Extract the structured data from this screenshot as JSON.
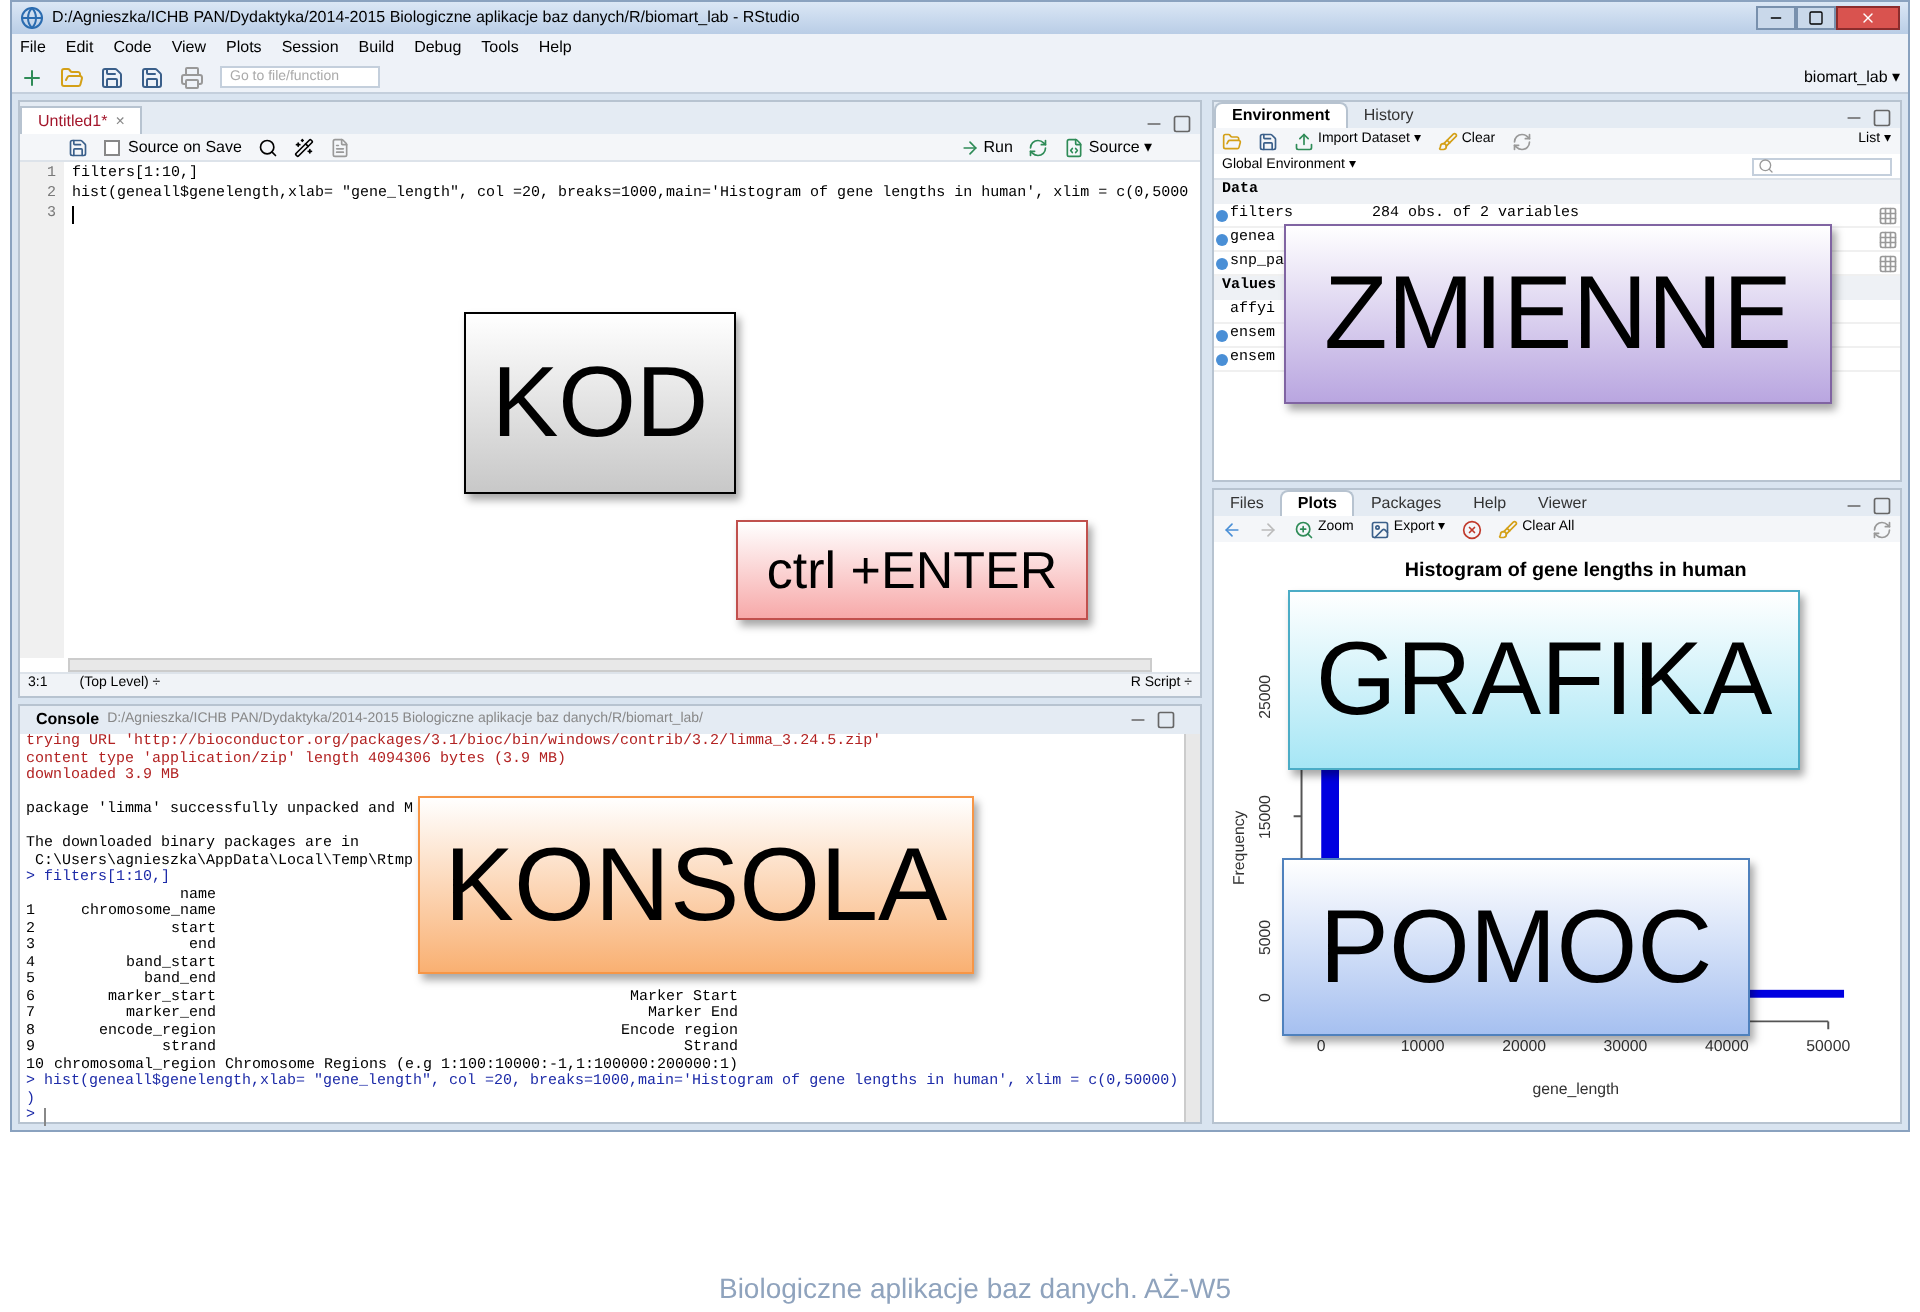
{
  "window": {
    "title": "D:/Agnieszka/ICHB PAN/Dydaktyka/2014-2015 Biologiczne aplikacje baz danych/R/biomart_lab - RStudio"
  },
  "menu": [
    "File",
    "Edit",
    "Code",
    "View",
    "Plots",
    "Session",
    "Build",
    "Debug",
    "Tools",
    "Help"
  ],
  "toolbar": {
    "goto_placeholder": "Go to file/function",
    "project": "biomart_lab ▾"
  },
  "editor": {
    "tabs": [
      {
        "label": "Untitled1*",
        "selected": true
      }
    ],
    "close": "×",
    "source_on_save": "Source on Save",
    "source_on_save_checked": false,
    "run": "Run",
    "source": "Source ▾",
    "lines": [
      {
        "number": "1",
        "code": "filters[1:10,]"
      },
      {
        "number": "2",
        "code": "hist(geneall$genelength,xlab= \"gene_length\", col =20, breaks=1000,main='Histogram of gene lengths in human', xlim = c(0,5000"
      },
      {
        "number": "3"
      }
    ],
    "status": {
      "position": "3:1",
      "scope": "(Top Level) ÷",
      "type": "R Script ÷"
    }
  },
  "console": {
    "title": "Console",
    "path": "D:/Agnieszka/ICHB PAN/Dydaktyka/2014-2015 Biologiczne aplikacje baz danych/R/biomart_lab/",
    "lines": [
      {
        "kind": "error",
        "text": "trying URL 'http://bioconductor.org/packages/3.1/bioc/bin/windows/contrib/3.2/limma_3.24.5.zip'"
      },
      {
        "kind": "error",
        "text": "content type 'application/zip' length 4094306 bytes (3.9 MB)"
      },
      {
        "kind": "error",
        "text": "downloaded 3.9 MB"
      },
      {
        "kind": "blank"
      },
      {
        "kind": "output",
        "text": "package 'limma' successfully unpacked and M"
      },
      {
        "kind": "blank"
      },
      {
        "kind": "output",
        "text": "The downloaded binary packages are in"
      },
      {
        "kind": "output",
        "text": " C:\\Users\\agnieszka\\AppData\\Local\\Temp\\Rtmp"
      },
      {
        "kind": "input",
        "text": "> filters[1:10,]"
      }
    ],
    "table": {
      "header": "name",
      "rows": [
        {
          "index": "1",
          "name": "chromosome_name"
        },
        {
          "index": "2",
          "name": "start"
        },
        {
          "index": "3",
          "name": "end"
        },
        {
          "index": "4",
          "name": "band_start"
        },
        {
          "index": "5",
          "name": "band_end"
        },
        {
          "index": "6",
          "name": "marker_start",
          "description": "Marker Start"
        },
        {
          "index": "7",
          "name": "marker_end",
          "description": "Marker End"
        },
        {
          "index": "8",
          "name": "encode_region",
          "description": "Encode region"
        },
        {
          "index": "9",
          "name": "strand",
          "description": "Strand"
        },
        {
          "index": "10",
          "name": "chromosomal_region",
          "description": "Chromosome Regions (e.g 1:100:10000:-1,1:100000:200000:1)"
        }
      ]
    },
    "after": [
      {
        "kind": "input",
        "text": "> hist(geneall$genelength,xlab= \"gene_length\", col =20, breaks=1000,main='Histogram of gene lengths in human', xlim = c(0,50000)"
      },
      {
        "kind": "input",
        "text": ")"
      },
      {
        "kind": "prompt",
        "text": ">"
      }
    ]
  },
  "environment": {
    "tabs": [
      {
        "label": "Environment",
        "selected": true
      },
      {
        "label": "History",
        "selected": false
      }
    ],
    "import": "Import Dataset ▾",
    "clear": "Clear",
    "view": "List ▾",
    "scope": "Global Environment ▾",
    "sections": [
      {
        "kind": "data",
        "title": "Data",
        "rows": [
          {
            "name": "filters",
            "value": "284 obs. of 2 variables",
            "expandable": true
          },
          {
            "name": "genea",
            "expandable": true
          },
          {
            "name": "snp_pa",
            "expandable": true
          }
        ]
      },
      {
        "kind": "values",
        "title": "Values",
        "rows": [
          {
            "name": "affyi",
            "expandable": false
          },
          {
            "name": "ensem",
            "expandable": true
          },
          {
            "name": "ensem",
            "expandable": true
          }
        ]
      }
    ]
  },
  "files": {
    "tabs": [
      {
        "label": "Files",
        "selected": false
      },
      {
        "label": "Plots",
        "selected": true
      },
      {
        "label": "Packages",
        "selected": false
      },
      {
        "label": "Help",
        "selected": false
      },
      {
        "label": "Viewer",
        "selected": false
      }
    ],
    "zoom": "Zoom",
    "export": "Export ▾",
    "clear_all": "Clear All",
    "plot": {
      "title": "Histogram of gene lengths in human",
      "ylabel": "Frequency",
      "xlabel": "gene_length",
      "yticks": [
        "0",
        "5000",
        "15000",
        "25000"
      ],
      "xticks": [
        "0",
        "10000",
        "20000",
        "30000",
        "40000",
        "50000"
      ]
    }
  },
  "labels": [
    {
      "text": "KOD",
      "color": "#c8c8c8"
    },
    {
      "text": "ctrl +ENTER",
      "color": "#f7a9a9"
    },
    {
      "text": "ZMIENNE",
      "color": "#b9a6e0"
    },
    {
      "text": "GRAFIKA",
      "color": "#a6e6f5"
    },
    {
      "text": "KONSOLA",
      "color": "#f9b072"
    },
    {
      "text": "POMOC",
      "color": "#a6c0f0"
    }
  ],
  "footer": "Biologiczne aplikacje baz danych. AŻ-W5"
}
